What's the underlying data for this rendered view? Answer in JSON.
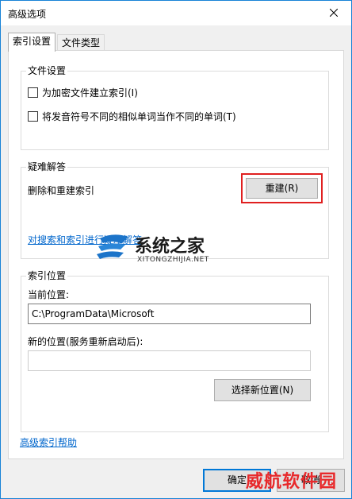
{
  "window": {
    "title": "高级选项"
  },
  "tabs": [
    {
      "label": "索引设置",
      "active": true
    },
    {
      "label": "文件类型",
      "active": false
    }
  ],
  "file_settings": {
    "legend": "文件设置",
    "options": [
      {
        "label": "为加密文件建立索引(I)",
        "checked": false
      },
      {
        "label": "将发音符号不同的相似单词当作不同的单词(T)",
        "checked": false
      }
    ]
  },
  "troubleshooting": {
    "legend": "疑难解答",
    "text": "删除和重建索引",
    "rebuild_button": "重建(R)",
    "link": "对搜索和索引进行疑难解答"
  },
  "index_location": {
    "legend": "索引位置",
    "current_label": "当前位置:",
    "current_value": "C:\\ProgramData\\Microsoft",
    "new_label": "新的位置(服务重新启动后):",
    "new_value": "",
    "select_button": "选择新位置(N)"
  },
  "help_link": "高级索引帮助",
  "footer": {
    "ok": "确定",
    "cancel": "取消"
  },
  "watermarks": {
    "site_name": "系统之家",
    "site_url": "XITONGZHIJIA.NET",
    "corner": "威航软件园"
  },
  "colors": {
    "accent": "#0078d7",
    "link": "#0066cc",
    "highlight": "#e02020",
    "watermark_red": "#e8292b"
  }
}
